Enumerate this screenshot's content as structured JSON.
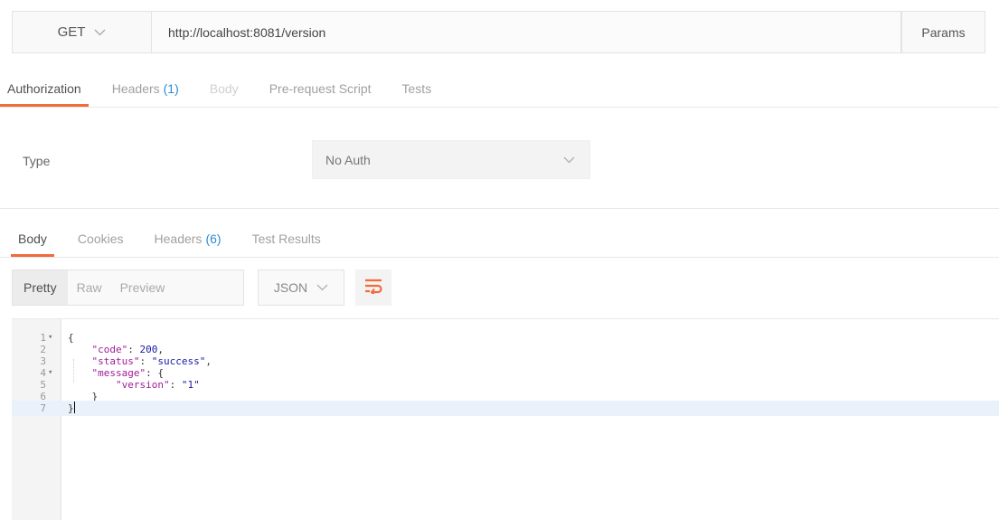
{
  "request": {
    "method": "GET",
    "url": "http://localhost:8081/version",
    "params_label": "Params"
  },
  "request_tabs": [
    {
      "label": "Authorization",
      "count": "",
      "state": "active"
    },
    {
      "label": "Headers",
      "count": "(1)",
      "state": "normal"
    },
    {
      "label": "Body",
      "count": "",
      "state": "disabled"
    },
    {
      "label": "Pre-request Script",
      "count": "",
      "state": "normal"
    },
    {
      "label": "Tests",
      "count": "",
      "state": "normal"
    }
  ],
  "auth": {
    "type_label": "Type",
    "type_value": "No Auth"
  },
  "response_tabs": [
    {
      "label": "Body",
      "count": "",
      "state": "active"
    },
    {
      "label": "Cookies",
      "count": "",
      "state": "normal"
    },
    {
      "label": "Headers",
      "count": "(6)",
      "state": "normal"
    },
    {
      "label": "Test Results",
      "count": "",
      "state": "normal"
    }
  ],
  "response_toolbar": {
    "views": [
      "Pretty",
      "Raw",
      "Preview"
    ],
    "active_view": "Pretty",
    "format": "JSON",
    "wrap_icon": "wrap-lines-icon"
  },
  "code_lines": [
    {
      "n": "1",
      "fold": true,
      "text": "{"
    },
    {
      "n": "2",
      "fold": false,
      "text": "    \"code\": 200,"
    },
    {
      "n": "3",
      "fold": false,
      "text": "    \"status\": \"success\","
    },
    {
      "n": "4",
      "fold": true,
      "text": "    \"message\": {"
    },
    {
      "n": "5",
      "fold": false,
      "text": "        \"version\": \"1\""
    },
    {
      "n": "6",
      "fold": false,
      "text": "    }"
    },
    {
      "n": "7",
      "fold": false,
      "text": "}"
    }
  ],
  "colors": {
    "accent": "#f26b3a",
    "count": "#2a8cd6",
    "json_key": "#a01d98",
    "json_value": "#1a1aa6",
    "active_line": "#e9f1fb"
  }
}
